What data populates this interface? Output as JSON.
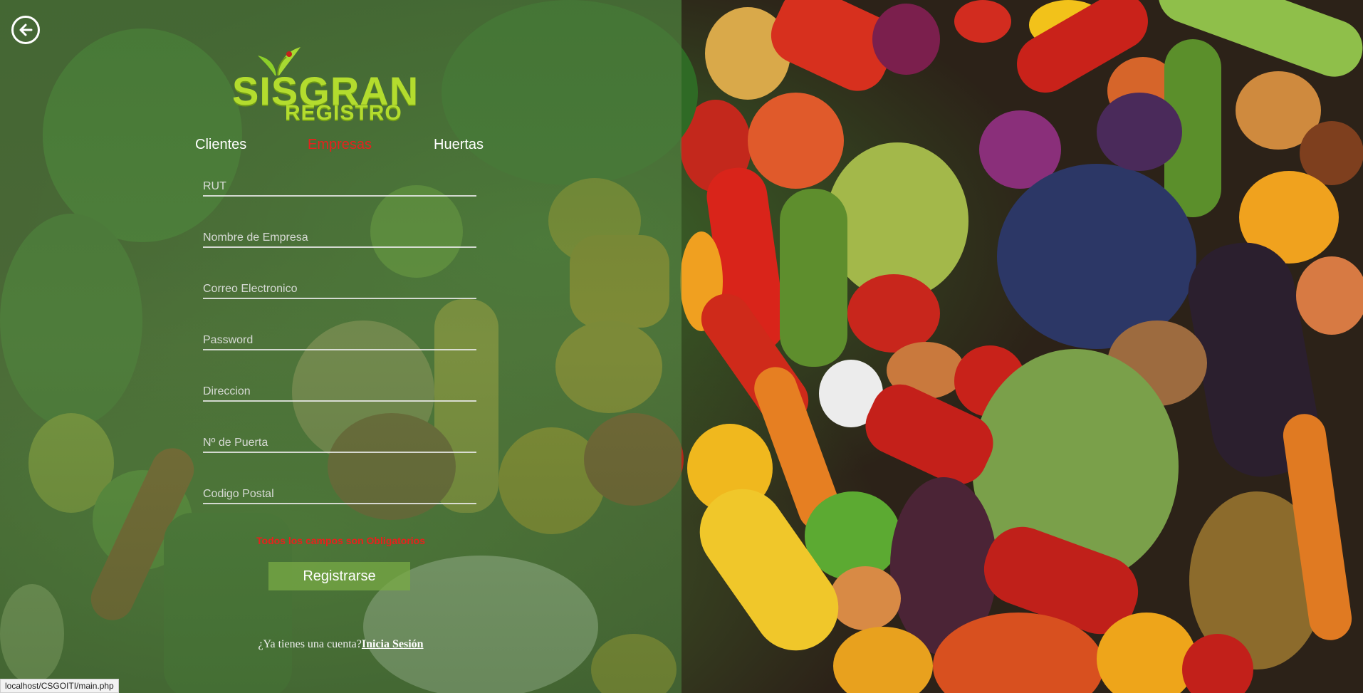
{
  "app": {
    "logo_title": "SISGRAN",
    "logo_subtitle": "REGISTRO"
  },
  "back_button": {
    "icon": "arrow-left-circle-icon"
  },
  "tabs": [
    {
      "label": "Clientes",
      "active": false
    },
    {
      "label": "Empresas",
      "active": true
    },
    {
      "label": "Huertas",
      "active": false
    }
  ],
  "form": {
    "fields": [
      {
        "placeholder": "RUT",
        "value": ""
      },
      {
        "placeholder": "Nombre de Empresa",
        "value": ""
      },
      {
        "placeholder": "Correo Electronico",
        "value": ""
      },
      {
        "placeholder": "Password",
        "value": ""
      },
      {
        "placeholder": "Direccion",
        "value": ""
      },
      {
        "placeholder": "Nº de Puerta",
        "value": ""
      },
      {
        "placeholder": "Codigo Postal",
        "value": ""
      }
    ],
    "required_note": "Todos los campos son Obligatorios",
    "submit_label": "Registrarse"
  },
  "account": {
    "prompt": "¿Ya tienes una cuenta?",
    "link_label": "Inicia Sesión"
  },
  "statusbar": {
    "url": "localhost/CSGOITI/main.php"
  },
  "colors": {
    "accent_active": "#e8201c",
    "logo_green": "#b3dc2e",
    "panel_overlay": "#4a783a",
    "button_bg": "#78aa46"
  }
}
